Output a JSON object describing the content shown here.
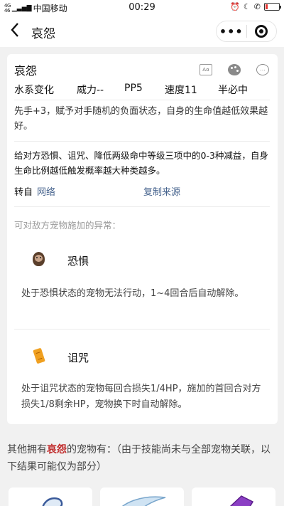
{
  "status_bar": {
    "signal_top": "4G",
    "signal_bottom": "46",
    "carrier": "中国移动",
    "time": "00:29",
    "right_icons": [
      "alarm-icon",
      "moon-icon",
      "hd-call-icon",
      "battery-icon"
    ],
    "battery_level": 0.15,
    "battery_color": "#e53935"
  },
  "nav": {
    "title": "哀怨",
    "more_label": "•••"
  },
  "skill": {
    "name": "哀怨",
    "icon_book_label": "Aα",
    "icon_chat_label": "…",
    "attribute": "水系变化",
    "power": "威力--",
    "pp": "PP5",
    "speed": "速度11",
    "hit": "半必中",
    "description": "先手+3，赋予对手随机的负面状态，自身的生命值越低效果越好。",
    "detail": "给对方恐惧、诅咒、降低两级命中等级三项中的0-3种减益，自身生命比例越低触发概率越大种类越多。",
    "source_label": "转自",
    "source_value": "网络",
    "copy_source": "复制来源"
  },
  "abnormal": {
    "title": "可对敌方宠物施加的异常：",
    "items": [
      {
        "name": "恐惧",
        "icon": "fear-icon",
        "description": "处于恐惧状态的宠物无法行动，1~4回合后自动解除。"
      },
      {
        "name": "诅咒",
        "icon": "curse-icon",
        "description": "处于诅咒状态的宠物每回合损失1/4HP，施加的首回合对方损失1/8剩余HP，宠物换下时自动解除。"
      }
    ]
  },
  "others": {
    "prefix": "其他拥有",
    "skill": "哀怨",
    "suffix": "的宠物有：（由于技能尚未与全部宠物关联，以下结果可能仅为部分）"
  },
  "colors": {
    "link": "#47648e",
    "highlight": "#c02a2a",
    "background": "#f1f1f1"
  }
}
